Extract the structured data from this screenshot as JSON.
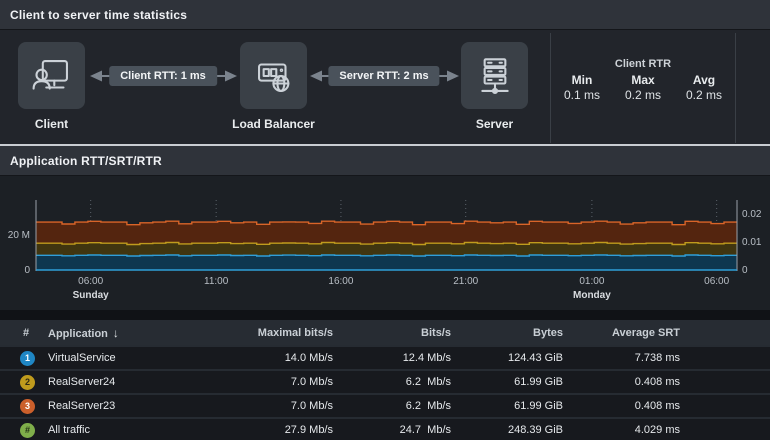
{
  "flow": {
    "title": "Client to server time statistics",
    "nodes": [
      {
        "label": "Client"
      },
      {
        "label": "Load Balancer"
      },
      {
        "label": "Server"
      }
    ],
    "links": [
      {
        "label": "Client RTT: 1 ms"
      },
      {
        "label": "Server RTT: 2 ms"
      }
    ],
    "stats": {
      "title": "Client RTR",
      "items": [
        {
          "label": "Min",
          "value": "0.1 ms"
        },
        {
          "label": "Max",
          "value": "0.2 ms"
        },
        {
          "label": "Avg",
          "value": "0.2 ms"
        }
      ]
    }
  },
  "chart": {
    "title": "Application RTT/SRT/RTR"
  },
  "chart_data": {
    "type": "area",
    "stacked": true,
    "title": "Application RTT/SRT/RTR",
    "x_ticks": [
      "06:00",
      "11:00",
      "16:00",
      "21:00",
      "01:00",
      "06:00"
    ],
    "x_tick_fractions": [
      0.078,
      0.257,
      0.435,
      0.613,
      0.793,
      0.971
    ],
    "day_labels": [
      {
        "text": "Sunday",
        "tick": 0
      },
      {
        "text": "Monday",
        "tick": 4
      }
    ],
    "y_left": {
      "unit": "bits/s (M = Mb/s)",
      "max": 40,
      "ticks": [
        {
          "label": "0",
          "value": 0
        },
        {
          "label": "20 M",
          "value": 20
        }
      ]
    },
    "y_right": {
      "max": 0.025,
      "ticks": [
        {
          "label": "0",
          "value": 0
        },
        {
          "label": "0.01",
          "value": 0.01
        },
        {
          "label": "0.02",
          "value": 0.02
        }
      ]
    },
    "grid": "vertical-dotted",
    "legend": "none",
    "note": "values are cumulative stack tops in Mb/s",
    "series": [
      {
        "name": "RealServer23 (stack top / all traffic)",
        "line_color": "#d96428",
        "fill_color": "#54250f",
        "values": [
          27.4,
          27.4,
          26.3,
          27.4,
          27.8,
          27.4,
          27.4,
          25.9,
          27.0,
          27.4,
          27.9,
          26.4,
          27.4,
          27.4,
          27.8,
          27.0,
          27.4,
          26.1,
          27.4,
          27.5,
          27.4,
          26.6,
          27.9,
          27.4,
          27.4,
          26.2,
          27.4,
          27.8,
          27.4,
          25.9,
          27.4,
          27.4,
          26.5,
          27.9,
          27.4,
          27.0,
          27.4,
          26.1,
          27.8,
          27.4,
          27.4,
          26.6,
          27.4,
          27.9,
          27.4,
          26.2,
          27.0,
          27.4,
          27.4,
          25.9,
          27.8,
          27.4,
          26.5,
          27.4
        ]
      },
      {
        "name": "RealServer24 (stacked on VirtualService)",
        "line_color": "#bf9b1d",
        "fill_color": "#403510",
        "values": [
          15.3,
          15.3,
          14.8,
          15.3,
          15.6,
          15.3,
          15.3,
          14.6,
          15.1,
          15.3,
          15.7,
          14.9,
          15.3,
          15.3,
          15.6,
          15.1,
          15.3,
          14.7,
          15.3,
          15.4,
          15.3,
          15.0,
          15.7,
          15.3,
          15.3,
          14.8,
          15.3,
          15.6,
          15.3,
          14.6,
          15.3,
          15.3,
          15.0,
          15.7,
          15.3,
          15.1,
          15.3,
          14.7,
          15.6,
          15.3,
          15.3,
          15.0,
          15.3,
          15.7,
          15.3,
          14.8,
          15.1,
          15.3,
          15.3,
          14.6,
          15.6,
          15.3,
          15.0,
          15.3
        ]
      },
      {
        "name": "VirtualService",
        "line_color": "#2f9fd8",
        "fill_color": "#0e374f",
        "values": [
          8.4,
          8.4,
          8.1,
          8.4,
          8.6,
          8.4,
          8.4,
          8.0,
          8.3,
          8.4,
          8.6,
          8.1,
          8.4,
          8.4,
          8.6,
          8.3,
          8.4,
          8.0,
          8.4,
          8.5,
          8.4,
          8.2,
          8.6,
          8.4,
          8.4,
          8.1,
          8.4,
          8.6,
          8.4,
          8.0,
          8.4,
          8.4,
          8.2,
          8.6,
          8.4,
          8.3,
          8.4,
          8.0,
          8.6,
          8.4,
          8.4,
          8.2,
          8.4,
          8.6,
          8.4,
          8.1,
          8.3,
          8.4,
          8.4,
          8.0,
          8.6,
          8.4,
          8.2,
          8.4
        ]
      }
    ]
  },
  "table": {
    "columns": [
      {
        "label": "#"
      },
      {
        "label": "Application",
        "sort_icon": "↓"
      },
      {
        "label": "Maximal bits/s"
      },
      {
        "label": "Bits/s"
      },
      {
        "label": "Bytes"
      },
      {
        "label": "Average SRT"
      }
    ],
    "rows": [
      {
        "badge": {
          "text": "1",
          "bg": "#1f86c4",
          "fg": "#ffffff"
        },
        "application": "VirtualService",
        "maximal": "14.0 Mb/s",
        "bits": "12.4 Mb/s",
        "bytes": "124.43 GiB",
        "srt": "7.738 ms"
      },
      {
        "badge": {
          "text": "2",
          "bg": "#bf9b1d",
          "fg": "#2e2a14"
        },
        "application": "RealServer24",
        "maximal": "7.0 Mb/s",
        "bits": "6.2  Mb/s",
        "bytes": "61.99 GiB",
        "srt": "0.408 ms"
      },
      {
        "badge": {
          "text": "3",
          "bg": "#cb5f2b",
          "fg": "#ffffff"
        },
        "application": "RealServer23",
        "maximal": "7.0 Mb/s",
        "bits": "6.2  Mb/s",
        "bytes": "61.99 GiB",
        "srt": "0.408 ms"
      },
      {
        "badge": {
          "text": "#",
          "bg": "#7fae4a",
          "fg": "#223014"
        },
        "application": "All traffic",
        "maximal": "27.9 Mb/s",
        "bits": "24.7  Mb/s",
        "bytes": "248.39 GiB",
        "srt": "4.029 ms"
      }
    ]
  },
  "colors": {
    "accent_blue": "#2f9fd8",
    "accent_yellow": "#bf9b1d",
    "accent_orange": "#d96428",
    "accent_green": "#7fae4a",
    "axis": "#9aa1a9",
    "grid_dots": "#5b626a"
  }
}
